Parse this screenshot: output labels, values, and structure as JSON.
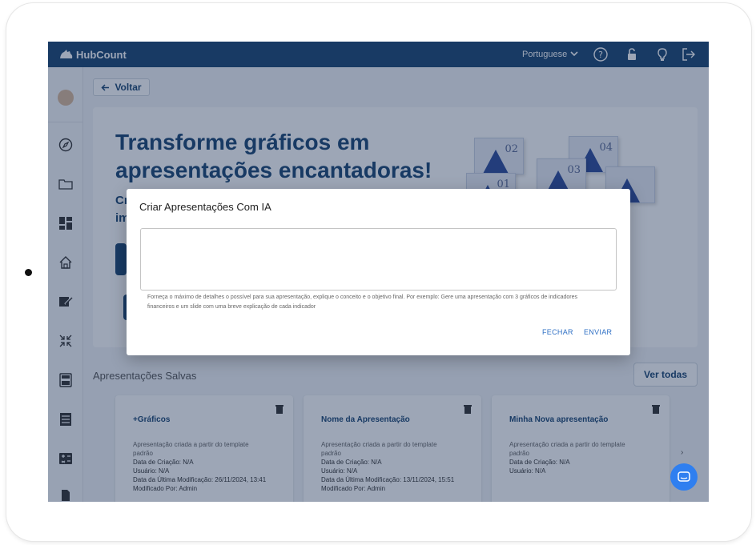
{
  "app": {
    "brand": "HubCount"
  },
  "topbar": {
    "language": "Portuguese",
    "icons": [
      "help-icon",
      "unlock-icon",
      "lightbulb-icon",
      "logout-icon"
    ]
  },
  "sidebar": {
    "icons": [
      "compass-icon",
      "folder-icon",
      "dashboard-icon",
      "home-icon",
      "edit-icon",
      "collapse-icon",
      "calculator-icon",
      "spreadsheet-icon",
      "calculator-alt-icon",
      "document-icon"
    ]
  },
  "main": {
    "back_label": "Voltar",
    "hero": {
      "title_line1": "Transforme gráficos em",
      "title_line2": "apresentações encantadoras!",
      "frag1": "Cr",
      "frag2": "im"
    },
    "slides": [
      "02",
      "04",
      "03",
      "01"
    ],
    "saved_label": "Apresentações Salvas",
    "see_all_label": "Ver todas",
    "cards": [
      {
        "title": "+Gráficos",
        "desc": "Apresentação criada a partir do template padrão",
        "meta": [
          "Data de Criação: N/A",
          "Usuário: N/A",
          "Data da Última Modificação: 26/11/2024, 13:41",
          "Modificado Por: Admin"
        ]
      },
      {
        "title": "Nome da Apresentação",
        "desc": "Apresentação criada a partir do template padrão",
        "meta": [
          "Data de Criação: N/A",
          "Usuário: N/A",
          "Data da Última Modificação: 13/11/2024, 15:51",
          "Modificado Por: Admin"
        ]
      },
      {
        "title": "Minha Nova apresentação",
        "desc": "Apresentação criada a partir do template padrão",
        "meta": [
          "Data de Criação: N/A",
          "Usuário: N/A"
        ]
      }
    ]
  },
  "modal": {
    "title": "Criar Apresentações Com IA",
    "textarea_value": "",
    "help_text": "Forneça o máximo de detalhes o possível para sua apresentação, explique o conceito e o objetivo final. Por exemplo: Gere uma apresentação com 3 gráficos de indicadores financeiros e um slide com uma breve explicação de cada indicador",
    "close_label": "FECHAR",
    "send_label": "ENVIAR"
  },
  "colors": {
    "brand": "#1a4673",
    "accent": "#2e6fc4",
    "chat": "#2f7ff0"
  }
}
